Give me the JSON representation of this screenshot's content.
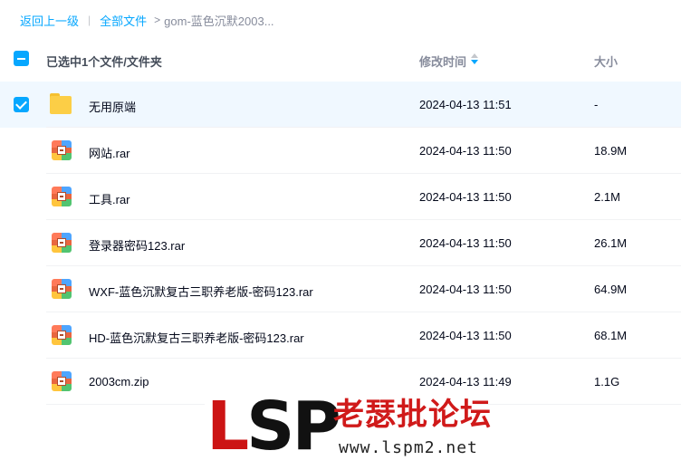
{
  "breadcrumb": {
    "back": "返回上一级",
    "all_files": "全部文件",
    "current": "gom-蓝色沉默2003..."
  },
  "header": {
    "selection": "已选中1个文件/文件夹",
    "modified": "修改时间",
    "size": "大小"
  },
  "files": [
    {
      "name": "无用原端",
      "time": "2024-04-13 11:51",
      "size": "-",
      "type": "folder",
      "selected": true
    },
    {
      "name": "网站.rar",
      "time": "2024-04-13 11:50",
      "size": "18.9M",
      "type": "archive",
      "selected": false
    },
    {
      "name": "工具.rar",
      "time": "2024-04-13 11:50",
      "size": "2.1M",
      "type": "archive",
      "selected": false
    },
    {
      "name": "登录器密码123.rar",
      "time": "2024-04-13 11:50",
      "size": "26.1M",
      "type": "archive",
      "selected": false
    },
    {
      "name": "WXF-蓝色沉默复古三职养老版-密码123.rar",
      "time": "2024-04-13 11:50",
      "size": "64.9M",
      "type": "archive",
      "selected": false
    },
    {
      "name": "HD-蓝色沉默复古三职养老版-密码123.rar",
      "time": "2024-04-13 11:50",
      "size": "68.1M",
      "type": "archive",
      "selected": false
    },
    {
      "name": "2003cm.zip",
      "time": "2024-04-13 11:49",
      "size": "1.1G",
      "type": "archive",
      "selected": false
    }
  ],
  "watermark": {
    "logo_left": "L",
    "logo_right": "SP",
    "title": "老瑟批论坛",
    "url": "www.lspm2.net"
  },
  "colors": {
    "accent": "#06a7ff",
    "selected_row": "#f0f8ff",
    "folder": "#fcce46"
  }
}
